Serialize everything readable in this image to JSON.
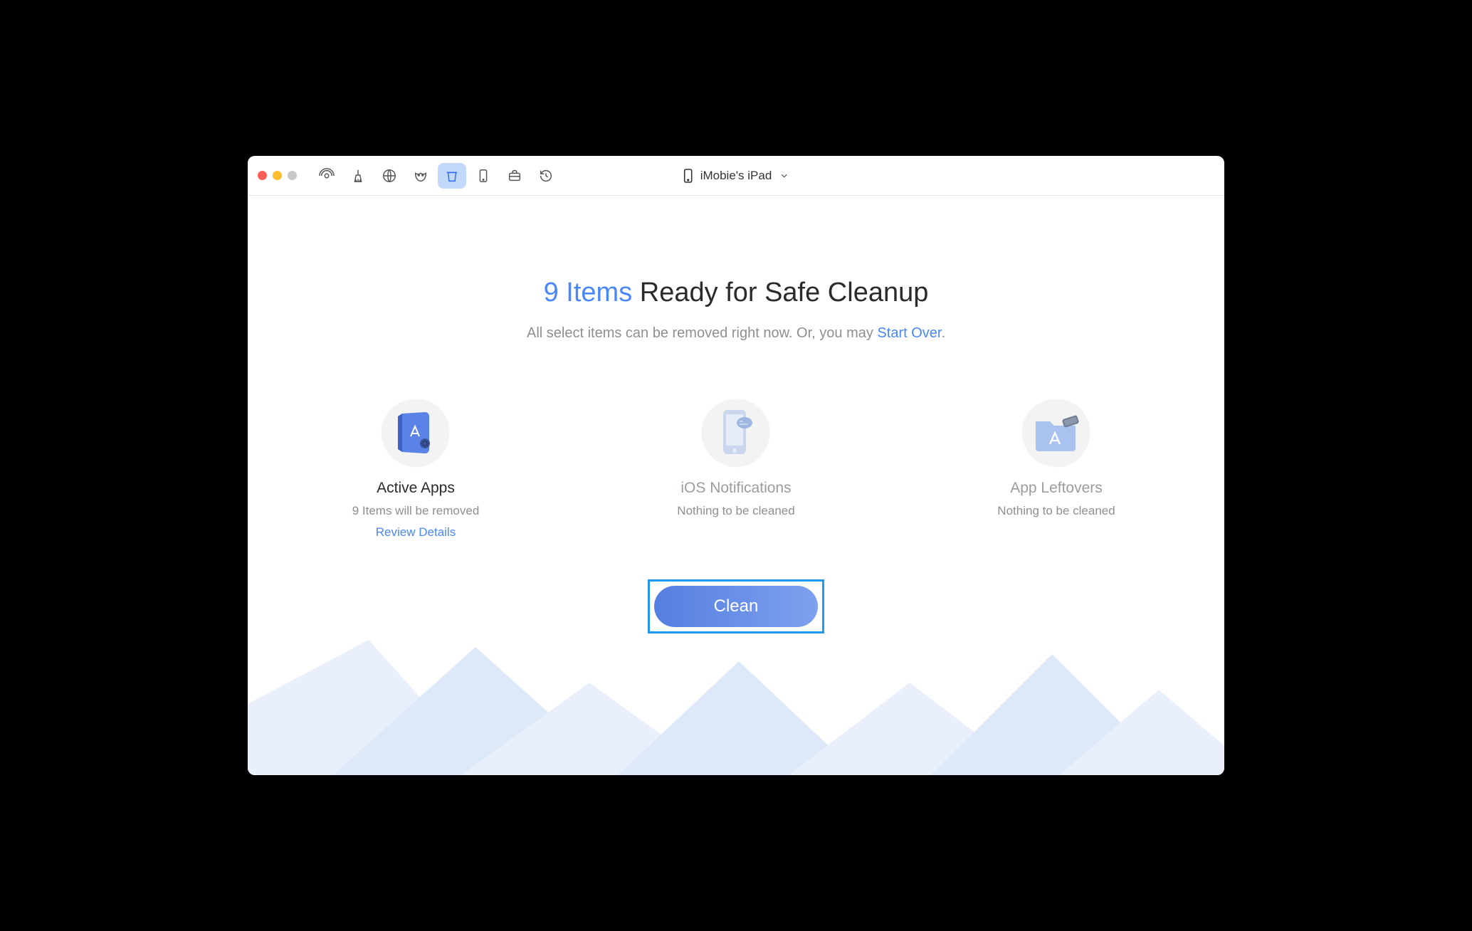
{
  "device": {
    "name": "iMobie's iPad"
  },
  "toolbar": {
    "icons": [
      "airplay",
      "broom",
      "globe",
      "mask",
      "trash",
      "phone",
      "briefcase",
      "clock"
    ],
    "active_index": 4
  },
  "headline": {
    "count_text": "9 Items",
    "rest": " Ready for Safe Cleanup"
  },
  "subline": {
    "prefix": "All select items can be removed right now. Or, you may ",
    "link": "Start Over",
    "suffix": "."
  },
  "cards": [
    {
      "id": "active-apps",
      "title": "Active Apps",
      "subtitle": "9 Items will be removed",
      "link": "Review Details",
      "state": "active"
    },
    {
      "id": "ios-notifications",
      "title": "iOS Notifications",
      "subtitle": "Nothing to be cleaned",
      "link": "",
      "state": "dim"
    },
    {
      "id": "app-leftovers",
      "title": "App Leftovers",
      "subtitle": "Nothing to be cleaned",
      "link": "",
      "state": "dim"
    }
  ],
  "clean_button": {
    "label": "Clean"
  },
  "colors": {
    "accent": "#4a87f8",
    "highlight_border": "#1f99f5",
    "muted_text": "#8d8f91"
  }
}
